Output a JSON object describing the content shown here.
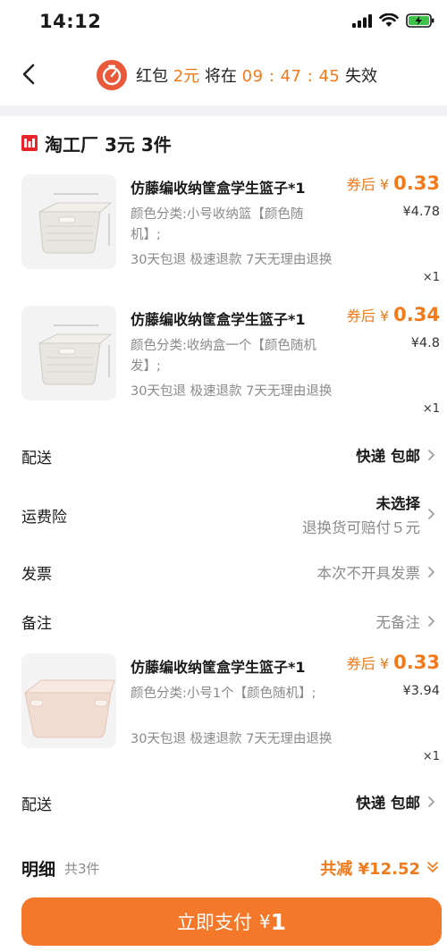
{
  "status_bar": {
    "time": "14:12"
  },
  "header": {
    "hongbao_prefix": "红包",
    "hongbao_amount": "2元",
    "hongbao_mid": "将在",
    "countdown": "09 : 47 : 45",
    "hongbao_suffix": "失效"
  },
  "shop": {
    "name": "淘工厂 3元 3件"
  },
  "products": [
    {
      "title": "仿藤编收纳筐盒学生篮子*1",
      "price_prefix": "券后",
      "currency": "¥",
      "price": "0.33",
      "spec": "颜色分类:小号收纳篮【颜色随机】;",
      "original_price": "¥4.78",
      "service": "30天包退  极速退款  7天无理由退换",
      "qty": "×1"
    },
    {
      "title": "仿藤编收纳筐盒学生篮子*1",
      "price_prefix": "券后",
      "currency": "¥",
      "price": "0.34",
      "spec": "颜色分类:收纳盒一个【颜色随机发】;",
      "original_price": "¥4.8",
      "service": "30天包退  极速退款  7天无理由退换",
      "qty": "×1"
    },
    {
      "title": "仿藤编收纳筐盒学生篮子*1",
      "price_prefix": "券后",
      "currency": "¥",
      "price": "0.33",
      "spec": "颜色分类:小号1个【颜色随机】;",
      "original_price": "¥3.94",
      "service": "30天包退  极速退款  7天无理由退换",
      "qty": "×1"
    }
  ],
  "options": {
    "delivery_label": "配送",
    "delivery_value": "快递 包邮",
    "insurance_label": "运费险",
    "insurance_value": "未选择",
    "insurance_sub": "退换货可赔付５元",
    "invoice_label": "发票",
    "invoice_value": "本次不开具发票",
    "note_label": "备注",
    "note_value": "无备注",
    "delivery2_label": "配送",
    "delivery2_value": "快递 包邮"
  },
  "summary": {
    "detail_label": "明细",
    "count": "共3件",
    "discount": "共减 ¥12.52"
  },
  "pay": {
    "label": "立即支付",
    "currency": "¥",
    "amount": "1"
  },
  "colors": {
    "accent": "#f4782a",
    "price_orange": "#f27a1a",
    "shop_red": "#e8242a"
  }
}
